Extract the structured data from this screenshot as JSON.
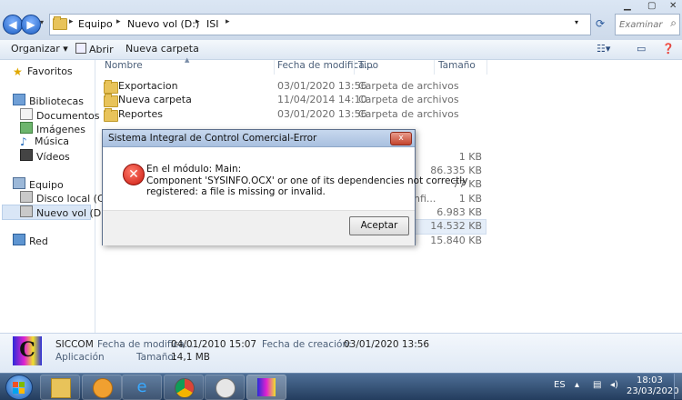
{
  "address": {
    "crumbs": [
      "Equipo",
      "Nuevo vol (D:)",
      "ISI"
    ],
    "search_placeholder": "Examinar ISI"
  },
  "toolbar": {
    "organize": "Organizar",
    "open": "Abrir",
    "new_folder": "Nueva carpeta"
  },
  "nav": {
    "favorites": "Favoritos",
    "libraries": "Bibliotecas",
    "library_items": [
      "Documentos",
      "Imágenes",
      "Música",
      "Vídeos"
    ],
    "computer": "Equipo",
    "drives": [
      "Disco local (C:)",
      "Nuevo vol (D:)"
    ],
    "network": "Red"
  },
  "columns": {
    "name": "Nombre",
    "date": "Fecha de modifica...",
    "type": "Tipo",
    "size": "Tamaño"
  },
  "files": [
    {
      "name": "Exportacion",
      "date": "03/01/2020 13:56",
      "type": "Carpeta de archivos",
      "size": ""
    },
    {
      "name": "Nueva carpeta",
      "date": "11/04/2014 14:10",
      "type": "Carpeta de archivos",
      "size": ""
    },
    {
      "name": "Reportes",
      "date": "03/01/2020 13:56",
      "type": "Carpeta de archivos",
      "size": ""
    }
  ],
  "hidden_sizes": [
    "1 KB",
    "86.335 KB",
    "77 KB",
    "1 KB",
    "6.983 KB",
    "14.532 KB",
    "15.840 KB"
  ],
  "hidden_type_fragment": "nfi...",
  "dialog": {
    "title": "Sistema Integral de Control Comercial-Error",
    "close": "x",
    "line1": "En el módulo: Main:",
    "line2": "Component 'SYSINFO.OCX' or one of its dependencies not correctly",
    "line3": "registered: a file is missing or invalid.",
    "ok": "Aceptar"
  },
  "details": {
    "app_name": "SICCOM",
    "app_kind": "Aplicación",
    "mod_label": "Fecha de modifica...",
    "mod_value": "04/01/2010 15:07",
    "size_label": "Tamaño:",
    "size_value": "14,1 MB",
    "created_label": "Fecha de creación:",
    "created_value": "03/01/2020 13:56"
  },
  "taskbar": {
    "lang": "ES",
    "time": "18:03",
    "date": "23/03/2020"
  },
  "colors": {
    "error_red": "#cc1a10",
    "selection": "#d9e6f6",
    "taskbar": "#243d5e"
  }
}
